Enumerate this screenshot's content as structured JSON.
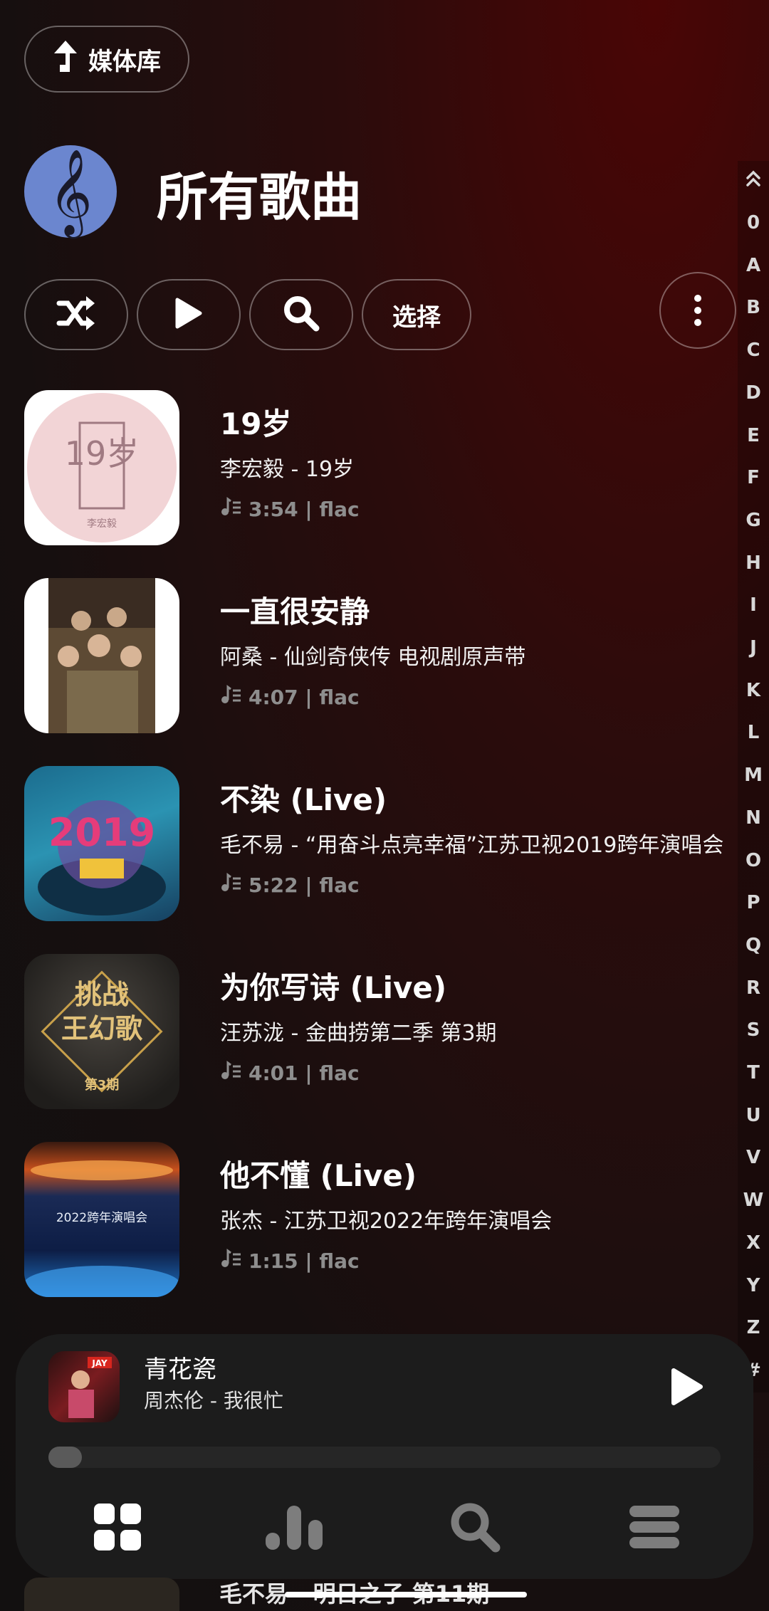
{
  "header": {
    "back_label": "媒体库",
    "title": "所有歌曲"
  },
  "actions": {
    "select_label": "选择"
  },
  "songs": [
    {
      "title": "19岁",
      "subtitle": "李宏毅 - 19岁",
      "meta": "3:54 | flac"
    },
    {
      "title": "一直很安静",
      "subtitle": "阿桑 - 仙剑奇侠传 电视剧原声带",
      "meta": "4:07 | flac"
    },
    {
      "title": "不染 (Live)",
      "subtitle": "毛不易 - “用奋斗点亮幸福”江苏卫视2019跨年演唱会",
      "meta": "5:22 | flac"
    },
    {
      "title": "为你写诗 (Live)",
      "subtitle": "汪苏泷 - 金曲捞第二季 第3期",
      "meta": "4:01 | flac"
    },
    {
      "title": "他不懂 (Live)",
      "subtitle": "张杰 - 江苏卫视2022年跨年演唱会",
      "meta": "1:15 | flac"
    }
  ],
  "covers": {
    "c1_text": "19岁",
    "c1_artist": "李宏毅",
    "c3_text": "2019",
    "c4_line1": "挑战",
    "c4_line2": "王幻歌",
    "c4_line3": "第3期",
    "c5_text": "2022跨年演唱会",
    "player_text": "JAY"
  },
  "index_letters": [
    "0",
    "A",
    "B",
    "C",
    "D",
    "E",
    "F",
    "G",
    "H",
    "I",
    "J",
    "K",
    "L",
    "M",
    "N",
    "O",
    "P",
    "Q",
    "R",
    "S",
    "T",
    "U",
    "V",
    "W",
    "X",
    "Y",
    "Z",
    "#"
  ],
  "player": {
    "title": "青花瓷",
    "subtitle": "周杰伦 - 我很忙",
    "progress": 0.05
  },
  "underlay": {
    "text": "毛不易 - 明日之子 第11期"
  },
  "colors": {
    "accent_icon": "#6b86cf",
    "player_bg": "#1c1c1c"
  },
  "icons": [
    "back-up-arrow-icon",
    "treble-clef-icon",
    "shuffle-icon",
    "play-icon",
    "search-icon",
    "more-vertical-icon",
    "music-note-list-icon",
    "grid-icon",
    "equalizer-icon",
    "menu-icon",
    "scroll-top-icon"
  ]
}
